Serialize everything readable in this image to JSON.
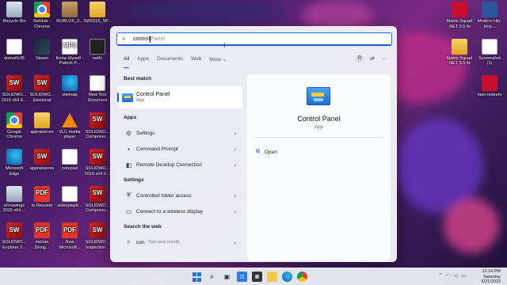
{
  "desktop": {
    "icons": [
      {
        "label": "Recycle Bin",
        "glyph": "",
        "style": "g-bin",
        "col": 0,
        "row": 0
      },
      {
        "label": "RelHub - Chrome",
        "glyph": "",
        "style": "g-chrome",
        "col": 1,
        "row": 0
      },
      {
        "label": "ROBLOX_2...",
        "glyph": "",
        "style": "g-box",
        "col": 2,
        "row": 0
      },
      {
        "label": "SW2015_SP...",
        "glyph": "",
        "style": "g-folder",
        "col": 3,
        "row": 0
      },
      {
        "label": "dotnetfx35",
        "glyph": "",
        "style": "g-doc",
        "col": 0,
        "row": 1
      },
      {
        "label": "Steam",
        "glyph": "",
        "style": "g-steam",
        "col": 1,
        "row": 1
      },
      {
        "label": "Know Myself - Patrick P...",
        "glyph": "MP3",
        "style": "g-doc",
        "col": 2,
        "row": 1
      },
      {
        "label": "netfx",
        "glyph": "",
        "style": "g-dark",
        "col": 3,
        "row": 1
      },
      {
        "label": "SOLIDWO... 2015 x64 E...",
        "glyph": "SW",
        "style": "g-sw",
        "col": 0,
        "row": 2
      },
      {
        "label": "SOLIDWO... Electrical",
        "glyph": "SW",
        "style": "g-sw",
        "col": 1,
        "row": 2
      },
      {
        "label": "sitemap",
        "glyph": "",
        "style": "g-edge",
        "col": 2,
        "row": 2
      },
      {
        "label": "New Text Document",
        "glyph": "",
        "style": "g-doc",
        "col": 3,
        "row": 2
      },
      {
        "label": "Google Chrome",
        "glyph": "",
        "style": "g-chrome",
        "col": 0,
        "row": 3
      },
      {
        "label": "appraserres",
        "glyph": "",
        "style": "g-folder",
        "col": 1,
        "row": 3
      },
      {
        "label": "VLC media player",
        "glyph": "",
        "style": "g-vlc",
        "col": 2,
        "row": 3
      },
      {
        "label": "SOLIDWO... Composer...",
        "glyph": "SW",
        "style": "g-sw",
        "col": 3,
        "row": 3
      },
      {
        "label": "Microsoft Edge",
        "glyph": "",
        "style": "g-edge",
        "col": 0,
        "row": 4
      },
      {
        "label": "appraiserres",
        "glyph": "SW",
        "style": "g-sw",
        "col": 1,
        "row": 4
      },
      {
        "label": "notepad",
        "glyph": "",
        "style": "g-doc",
        "col": 2,
        "row": 4
      },
      {
        "label": "SOLIDWO... 2015 x64 E...",
        "glyph": "SW",
        "style": "g-sw",
        "col": 3,
        "row": 4
      },
      {
        "label": "eDrawings 2015 x64 ...",
        "glyph": "",
        "style": "g-bin",
        "col": 0,
        "row": 5
      },
      {
        "label": "m Resume",
        "glyph": "PDF",
        "style": "g-pdf",
        "col": 1,
        "row": 5
      },
      {
        "label": "videoplayb...",
        "glyph": "",
        "style": "g-doc",
        "col": 2,
        "row": 5
      },
      {
        "label": "SOLIDWO... Composer...",
        "glyph": "SW",
        "style": "g-sw",
        "col": 3,
        "row": 5
      },
      {
        "label": "SOLIDWO... Explorer 2...",
        "glyph": "SW",
        "style": "g-sw",
        "col": 0,
        "row": 6
      },
      {
        "label": "mohan Desig...",
        "glyph": "PDF",
        "style": "g-pdf",
        "col": 1,
        "row": 6
      },
      {
        "label": "New Microsoft...",
        "glyph": "PDF",
        "style": "g-pdf",
        "col": 2,
        "row": 6
      },
      {
        "label": "SOLIDWO... Inspection...",
        "glyph": "SW",
        "style": "g-sw",
        "col": 3,
        "row": 6
      }
    ],
    "right_icons": [
      {
        "label": "Matrix Squad .NET 3.5 fix",
        "glyph": "",
        "style": "g-red",
        "col": 0,
        "row": 0
      },
      {
        "label": "Modern Hip-Hop...",
        "glyph": "",
        "style": "g-word",
        "col": 1,
        "row": 0
      },
      {
        "label": "Matrix Squad .NET 3.5 fix",
        "glyph": "",
        "style": "g-folder",
        "col": 0,
        "row": 1
      },
      {
        "label": "Screenshot (1)",
        "glyph": "",
        "style": "g-doc",
        "col": 1,
        "row": 1
      },
      {
        "label": "mas-redeem",
        "glyph": "",
        "style": "g-red",
        "col": 1,
        "row": 2
      }
    ]
  },
  "search": {
    "value": "control ",
    "placeholder": "Panel"
  },
  "tabs": [
    "All",
    "Apps",
    "Documents",
    "Web",
    "More"
  ],
  "tab_avatar": "R",
  "best_match": {
    "title": "Best match",
    "name": "Control Panel",
    "kind": "App"
  },
  "apps": {
    "title": "Apps",
    "items": [
      {
        "label": "Settings",
        "icon": "⚙"
      },
      {
        "label": "Command Prompt",
        "icon": "▪"
      },
      {
        "label": "Remote Desktop Connection",
        "icon": "◧"
      }
    ]
  },
  "settings_section": {
    "title": "Settings",
    "items": [
      {
        "label": "Controlled folder access",
        "icon": "⛨"
      },
      {
        "label": "Connect to a wireless display",
        "icon": "▭"
      }
    ]
  },
  "web_section": {
    "title": "Search the web",
    "items": [
      {
        "label": "con",
        "sub": "- See web results",
        "icon": "⌕"
      }
    ]
  },
  "preview": {
    "name": "Control Panel",
    "kind": "App",
    "action": "Open"
  },
  "taskbar": {
    "time": "12:14 PM",
    "day": "Saturday",
    "date": "5/21/2022",
    "tray_caret": "^"
  }
}
